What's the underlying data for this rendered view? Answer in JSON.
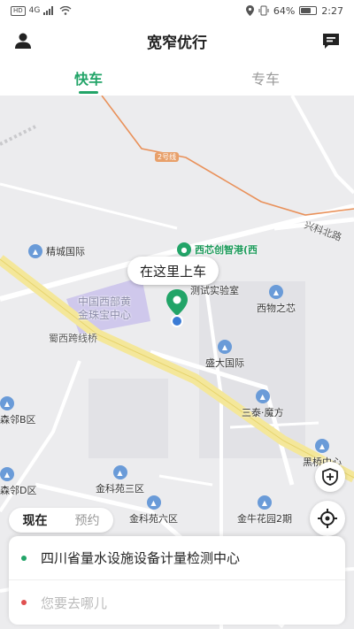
{
  "status_bar": {
    "network": "HD",
    "signal": "4G",
    "battery_percent": "64%",
    "battery_level": 0.64,
    "time": "2:27"
  },
  "header": {
    "title": "宽窄优行",
    "left_icon": "user-icon",
    "right_icon": "message-icon"
  },
  "tabs": [
    {
      "label": "快车",
      "active": true
    },
    {
      "label": "专车",
      "active": false
    }
  ],
  "map": {
    "road_badge": "2号线",
    "road_labels": {
      "xingke": "兴科北路",
      "shuxi": "蜀西跨线桥"
    },
    "pois": {
      "jingcheng": "精城国际",
      "xixin": "西芯创智港(西",
      "jianceshiyanshi": "测试实验室",
      "zhongguo1": "中国西部黄",
      "zhongguo2": "金珠宝中心",
      "xiwu": "西物之芯",
      "shengda": "盛大国际",
      "santai": "三泰·魔方",
      "senlinb": "森邻B区",
      "senlind": "森邻D区",
      "jinkesan": "金科苑三区",
      "jinkeliu": "金科苑六区",
      "jinniu": "金牛花园2期",
      "heiqiao": "黑桥中心"
    },
    "pickup_label": "在这里上车",
    "accent_color": "#22a468"
  },
  "time_toggle": [
    {
      "label": "现在",
      "active": true
    },
    {
      "label": "预约",
      "active": false
    }
  ],
  "address": {
    "from": "四川省量水设施设备计量检测中心",
    "to_placeholder": "您要去哪儿",
    "from_dot_color": "#22a468",
    "to_dot_color": "#e05050"
  }
}
